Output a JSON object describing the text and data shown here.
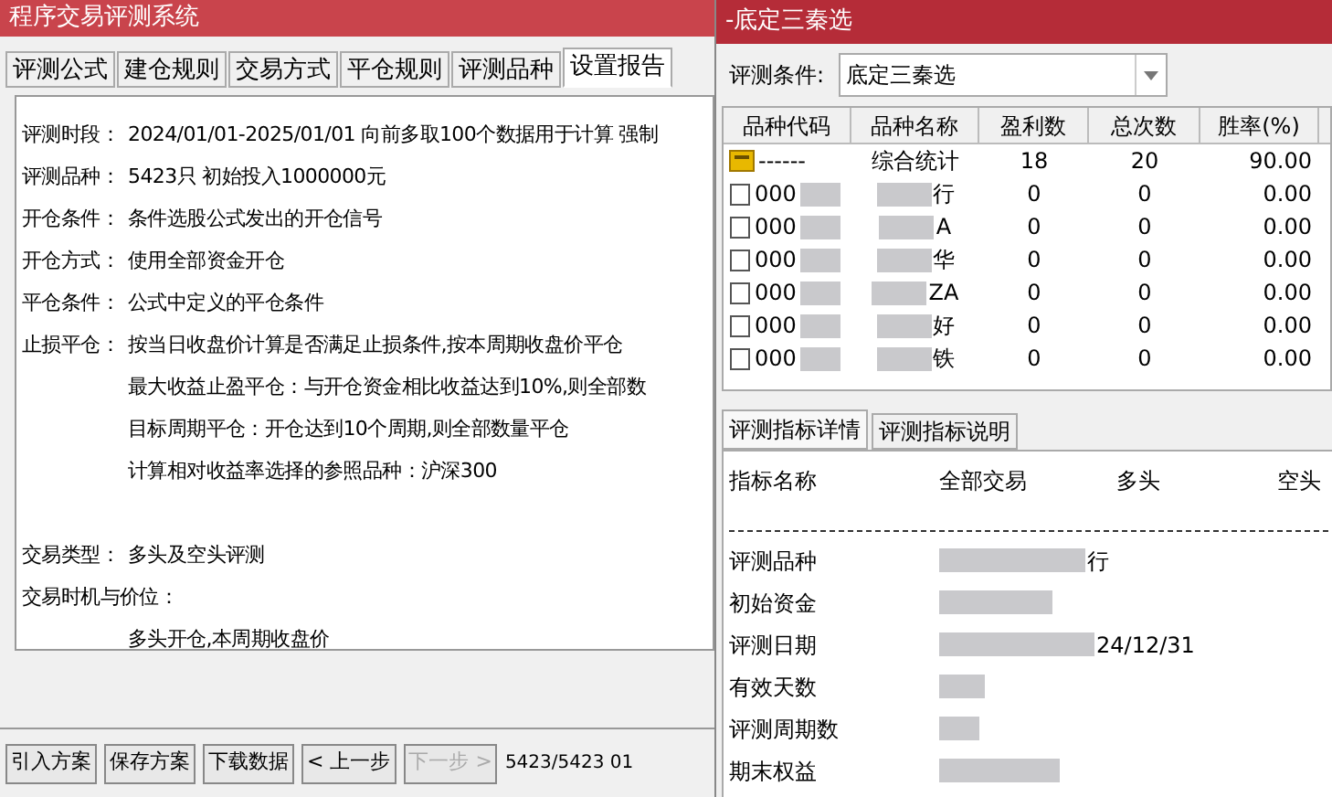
{
  "left_window": {
    "title": "程序交易评测系统",
    "tabs": [
      {
        "label": "评测公式",
        "selected": false
      },
      {
        "label": "建仓规则",
        "selected": false
      },
      {
        "label": "交易方式",
        "selected": false
      },
      {
        "label": "平仓规则",
        "selected": false
      },
      {
        "label": "评测品种",
        "selected": false
      },
      {
        "label": "设置报告",
        "selected": true
      }
    ],
    "report_lines": [
      {
        "kind": "field",
        "label": "评测时段：",
        "text": "2024/01/01-2025/01/01 向前多取100个数据用于计算 强制"
      },
      {
        "kind": "field",
        "label": "评测品种：",
        "text": "5423只 初始投入1000000元"
      },
      {
        "kind": "field",
        "label": "开仓条件：",
        "text": "条件选股公式发出的开仓信号"
      },
      {
        "kind": "field",
        "label": "开仓方式：",
        "text": "使用全部资金开仓"
      },
      {
        "kind": "field",
        "label": "平仓条件：",
        "text": "公式中定义的平仓条件"
      },
      {
        "kind": "field",
        "label": "止损平仓：",
        "text": "按当日收盘价计算是否满足止损条件,按本周期收盘价平仓"
      },
      {
        "kind": "indent",
        "text": "最大收益止盈平仓：与开仓资金相比收益达到10%,则全部数"
      },
      {
        "kind": "indent",
        "text": "目标周期平仓：开仓达到10个周期,则全部数量平仓"
      },
      {
        "kind": "indent",
        "text": "计算相对收益率选择的参照品种：沪深300"
      },
      {
        "kind": "blank"
      },
      {
        "kind": "field",
        "label": "交易类型：",
        "text": "多头及空头评测"
      },
      {
        "kind": "field",
        "label": "交易时机与价位："
      },
      {
        "kind": "indent",
        "text": "多头开仓,本周期收盘价"
      }
    ],
    "buttons": [
      {
        "label": "引入方案",
        "disabled": false
      },
      {
        "label": "保存方案",
        "disabled": false
      },
      {
        "label": "下载数据",
        "disabled": false
      },
      {
        "label": "< 上一步",
        "disabled": false
      },
      {
        "label": "下一步 >",
        "disabled": true
      }
    ],
    "status": "5423/5423 01"
  },
  "right_window": {
    "title": "-底定三秦选",
    "condition_label": "评测条件:",
    "condition_value": "底定三秦选",
    "table": {
      "columns": [
        "品种代码",
        "品种名称",
        "盈利数",
        "总次数",
        "胜率(%)"
      ],
      "rows": [
        {
          "kind": "summary",
          "code": "------",
          "name": "综合统计",
          "wins": "18",
          "total": "20",
          "rate": "90.00"
        },
        {
          "kind": "stock",
          "code": "000",
          "name": "行",
          "wins": "0",
          "total": "0",
          "rate": "0.00"
        },
        {
          "kind": "stock",
          "code": "000",
          "name": "A",
          "wins": "0",
          "total": "0",
          "rate": "0.00"
        },
        {
          "kind": "stock",
          "code": "000",
          "name": "华",
          "wins": "0",
          "total": "0",
          "rate": "0.00"
        },
        {
          "kind": "stock",
          "code": "000",
          "name": "ZA",
          "wins": "0",
          "total": "0",
          "rate": "0.00"
        },
        {
          "kind": "stock",
          "code": "000",
          "name": "好",
          "wins": "0",
          "total": "0",
          "rate": "0.00"
        },
        {
          "kind": "stock",
          "code": "000",
          "name": "铁",
          "wins": "0",
          "total": "0",
          "rate": "0.00"
        }
      ]
    },
    "detail_tabs": [
      {
        "label": "评测指标详情",
        "selected": true
      },
      {
        "label": "评测指标说明",
        "selected": false
      }
    ],
    "detail_columns": [
      "指标名称",
      "全部交易",
      "多头",
      "空头"
    ],
    "detail_rows": [
      {
        "label": "评测品种",
        "value": "行"
      },
      {
        "label": "初始资金"
      },
      {
        "label": "评测日期",
        "value": "24/12/31"
      },
      {
        "label": "有效天数"
      },
      {
        "label": "评测周期数"
      },
      {
        "label": "期末权益"
      }
    ]
  }
}
